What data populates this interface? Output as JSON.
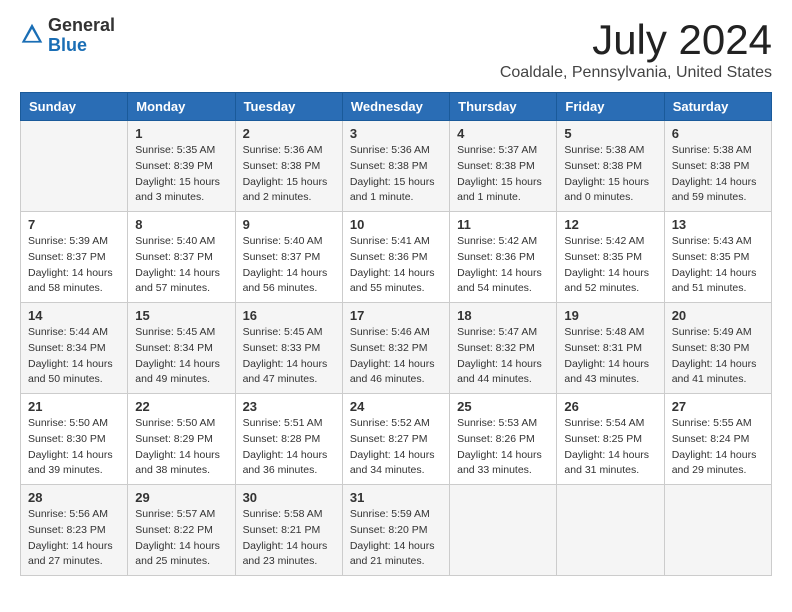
{
  "logo": {
    "general": "General",
    "blue": "Blue"
  },
  "header": {
    "month": "July 2024",
    "location": "Coaldale, Pennsylvania, United States"
  },
  "weekdays": [
    "Sunday",
    "Monday",
    "Tuesday",
    "Wednesday",
    "Thursday",
    "Friday",
    "Saturday"
  ],
  "weeks": [
    [
      {
        "day": "",
        "sunrise": "",
        "sunset": "",
        "daylight": ""
      },
      {
        "day": "1",
        "sunrise": "Sunrise: 5:35 AM",
        "sunset": "Sunset: 8:39 PM",
        "daylight": "Daylight: 15 hours and 3 minutes."
      },
      {
        "day": "2",
        "sunrise": "Sunrise: 5:36 AM",
        "sunset": "Sunset: 8:38 PM",
        "daylight": "Daylight: 15 hours and 2 minutes."
      },
      {
        "day": "3",
        "sunrise": "Sunrise: 5:36 AM",
        "sunset": "Sunset: 8:38 PM",
        "daylight": "Daylight: 15 hours and 1 minute."
      },
      {
        "day": "4",
        "sunrise": "Sunrise: 5:37 AM",
        "sunset": "Sunset: 8:38 PM",
        "daylight": "Daylight: 15 hours and 1 minute."
      },
      {
        "day": "5",
        "sunrise": "Sunrise: 5:38 AM",
        "sunset": "Sunset: 8:38 PM",
        "daylight": "Daylight: 15 hours and 0 minutes."
      },
      {
        "day": "6",
        "sunrise": "Sunrise: 5:38 AM",
        "sunset": "Sunset: 8:38 PM",
        "daylight": "Daylight: 14 hours and 59 minutes."
      }
    ],
    [
      {
        "day": "7",
        "sunrise": "Sunrise: 5:39 AM",
        "sunset": "Sunset: 8:37 PM",
        "daylight": "Daylight: 14 hours and 58 minutes."
      },
      {
        "day": "8",
        "sunrise": "Sunrise: 5:40 AM",
        "sunset": "Sunset: 8:37 PM",
        "daylight": "Daylight: 14 hours and 57 minutes."
      },
      {
        "day": "9",
        "sunrise": "Sunrise: 5:40 AM",
        "sunset": "Sunset: 8:37 PM",
        "daylight": "Daylight: 14 hours and 56 minutes."
      },
      {
        "day": "10",
        "sunrise": "Sunrise: 5:41 AM",
        "sunset": "Sunset: 8:36 PM",
        "daylight": "Daylight: 14 hours and 55 minutes."
      },
      {
        "day": "11",
        "sunrise": "Sunrise: 5:42 AM",
        "sunset": "Sunset: 8:36 PM",
        "daylight": "Daylight: 14 hours and 54 minutes."
      },
      {
        "day": "12",
        "sunrise": "Sunrise: 5:42 AM",
        "sunset": "Sunset: 8:35 PM",
        "daylight": "Daylight: 14 hours and 52 minutes."
      },
      {
        "day": "13",
        "sunrise": "Sunrise: 5:43 AM",
        "sunset": "Sunset: 8:35 PM",
        "daylight": "Daylight: 14 hours and 51 minutes."
      }
    ],
    [
      {
        "day": "14",
        "sunrise": "Sunrise: 5:44 AM",
        "sunset": "Sunset: 8:34 PM",
        "daylight": "Daylight: 14 hours and 50 minutes."
      },
      {
        "day": "15",
        "sunrise": "Sunrise: 5:45 AM",
        "sunset": "Sunset: 8:34 PM",
        "daylight": "Daylight: 14 hours and 49 minutes."
      },
      {
        "day": "16",
        "sunrise": "Sunrise: 5:45 AM",
        "sunset": "Sunset: 8:33 PM",
        "daylight": "Daylight: 14 hours and 47 minutes."
      },
      {
        "day": "17",
        "sunrise": "Sunrise: 5:46 AM",
        "sunset": "Sunset: 8:32 PM",
        "daylight": "Daylight: 14 hours and 46 minutes."
      },
      {
        "day": "18",
        "sunrise": "Sunrise: 5:47 AM",
        "sunset": "Sunset: 8:32 PM",
        "daylight": "Daylight: 14 hours and 44 minutes."
      },
      {
        "day": "19",
        "sunrise": "Sunrise: 5:48 AM",
        "sunset": "Sunset: 8:31 PM",
        "daylight": "Daylight: 14 hours and 43 minutes."
      },
      {
        "day": "20",
        "sunrise": "Sunrise: 5:49 AM",
        "sunset": "Sunset: 8:30 PM",
        "daylight": "Daylight: 14 hours and 41 minutes."
      }
    ],
    [
      {
        "day": "21",
        "sunrise": "Sunrise: 5:50 AM",
        "sunset": "Sunset: 8:30 PM",
        "daylight": "Daylight: 14 hours and 39 minutes."
      },
      {
        "day": "22",
        "sunrise": "Sunrise: 5:50 AM",
        "sunset": "Sunset: 8:29 PM",
        "daylight": "Daylight: 14 hours and 38 minutes."
      },
      {
        "day": "23",
        "sunrise": "Sunrise: 5:51 AM",
        "sunset": "Sunset: 8:28 PM",
        "daylight": "Daylight: 14 hours and 36 minutes."
      },
      {
        "day": "24",
        "sunrise": "Sunrise: 5:52 AM",
        "sunset": "Sunset: 8:27 PM",
        "daylight": "Daylight: 14 hours and 34 minutes."
      },
      {
        "day": "25",
        "sunrise": "Sunrise: 5:53 AM",
        "sunset": "Sunset: 8:26 PM",
        "daylight": "Daylight: 14 hours and 33 minutes."
      },
      {
        "day": "26",
        "sunrise": "Sunrise: 5:54 AM",
        "sunset": "Sunset: 8:25 PM",
        "daylight": "Daylight: 14 hours and 31 minutes."
      },
      {
        "day": "27",
        "sunrise": "Sunrise: 5:55 AM",
        "sunset": "Sunset: 8:24 PM",
        "daylight": "Daylight: 14 hours and 29 minutes."
      }
    ],
    [
      {
        "day": "28",
        "sunrise": "Sunrise: 5:56 AM",
        "sunset": "Sunset: 8:23 PM",
        "daylight": "Daylight: 14 hours and 27 minutes."
      },
      {
        "day": "29",
        "sunrise": "Sunrise: 5:57 AM",
        "sunset": "Sunset: 8:22 PM",
        "daylight": "Daylight: 14 hours and 25 minutes."
      },
      {
        "day": "30",
        "sunrise": "Sunrise: 5:58 AM",
        "sunset": "Sunset: 8:21 PM",
        "daylight": "Daylight: 14 hours and 23 minutes."
      },
      {
        "day": "31",
        "sunrise": "Sunrise: 5:59 AM",
        "sunset": "Sunset: 8:20 PM",
        "daylight": "Daylight: 14 hours and 21 minutes."
      },
      {
        "day": "",
        "sunrise": "",
        "sunset": "",
        "daylight": ""
      },
      {
        "day": "",
        "sunrise": "",
        "sunset": "",
        "daylight": ""
      },
      {
        "day": "",
        "sunrise": "",
        "sunset": "",
        "daylight": ""
      }
    ]
  ]
}
